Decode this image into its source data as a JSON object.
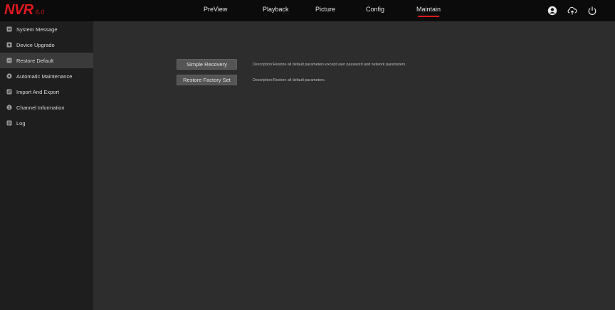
{
  "brand": {
    "name": "NVR",
    "version": "6.0"
  },
  "nav": {
    "items": [
      {
        "label": "PreView"
      },
      {
        "label": "Playback"
      },
      {
        "label": "Picture"
      },
      {
        "label": "Config"
      },
      {
        "label": "Maintain",
        "active": true
      }
    ]
  },
  "top_icons": [
    "user-icon",
    "cloud-upload-icon",
    "power-icon"
  ],
  "sidebar": {
    "items": [
      {
        "label": "System Message",
        "icon": "document-icon"
      },
      {
        "label": "Device Upgrade",
        "icon": "upgrade-icon"
      },
      {
        "label": "Restore Default",
        "icon": "restore-icon",
        "active": true
      },
      {
        "label": "Automatic Maintenance",
        "icon": "gear-icon"
      },
      {
        "label": "Import And Export",
        "icon": "import-export-icon"
      },
      {
        "label": "Channel Information",
        "icon": "info-icon"
      },
      {
        "label": "Log",
        "icon": "log-icon"
      }
    ]
  },
  "main": {
    "simple_recovery": {
      "button_label": "Simple Recovery",
      "description": "Description:Restore all default parameters except user password and network parameters."
    },
    "restore_factory": {
      "button_label": "Restore Factory Set",
      "description": "Description:Restore all default parameters."
    }
  },
  "colors": {
    "accent": "#e0191e",
    "topbar_bg": "#0b0b0b",
    "sidebar_bg": "#1e1e1e",
    "sidebar_active_bg": "#3a3a3a",
    "content_bg": "#2d2d2d",
    "button_bg": "#555555"
  }
}
